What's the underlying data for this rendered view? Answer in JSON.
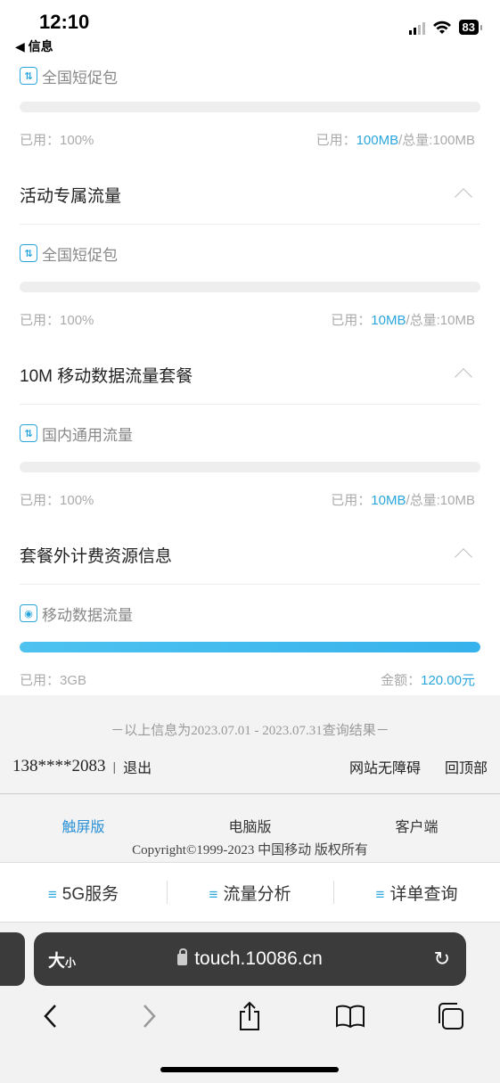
{
  "status_bar": {
    "time": "12:10",
    "back_app": "◀ 信息",
    "battery": "83"
  },
  "sections": [
    {
      "title": "",
      "items": [
        {
          "name": "全国短促包",
          "used_label": "已用：",
          "used_pct": "100%",
          "used_right_label": "已用：",
          "used_amount": "100MB",
          "total_label": "/总量:100MB",
          "fill": 0
        }
      ]
    },
    {
      "title": "活动专属流量",
      "items": [
        {
          "name": "全国短促包",
          "used_label": "已用：",
          "used_pct": "100%",
          "used_right_label": "已用：",
          "used_amount": "10MB",
          "total_label": "/总量:10MB",
          "fill": 0
        }
      ]
    },
    {
      "title": "10M 移动数据流量套餐",
      "items": [
        {
          "name": "国内通用流量",
          "used_label": "已用：",
          "used_pct": "100%",
          "used_right_label": "已用：",
          "used_amount": "10MB",
          "total_label": "/总量:10MB",
          "fill": 0
        }
      ]
    },
    {
      "title": "套餐外计费资源信息",
      "items": [
        {
          "name": "移动数据流量",
          "used_label": "已用：",
          "used_pct": "3GB",
          "used_right_label": "金额：",
          "used_amount": "120.00元",
          "total_label": "",
          "fill": 1
        }
      ]
    }
  ],
  "footer": {
    "query_note": "－以上信息为2023.07.01 - 2023.07.31查询结果－",
    "phone": "138****2083",
    "separator": "|",
    "logout": "退出",
    "accessible": "网站无障碍",
    "back_top": "回顶部",
    "version_touch": "触屏版",
    "version_pc": "电脑版",
    "version_client": "客户端",
    "copyright": "Copyright©1999-2023 中国移动 版权所有"
  },
  "bottom_nav": {
    "item1": "5G服务",
    "item2": "流量分析",
    "item3": "详单查询",
    "menu_glyph": "≡"
  },
  "safari": {
    "aa": "大",
    "aa_small": "小",
    "url": "touch.10086.cn"
  },
  "colors": {
    "accent": "#2aa6dd",
    "link_blue": "#2a8fd6"
  }
}
